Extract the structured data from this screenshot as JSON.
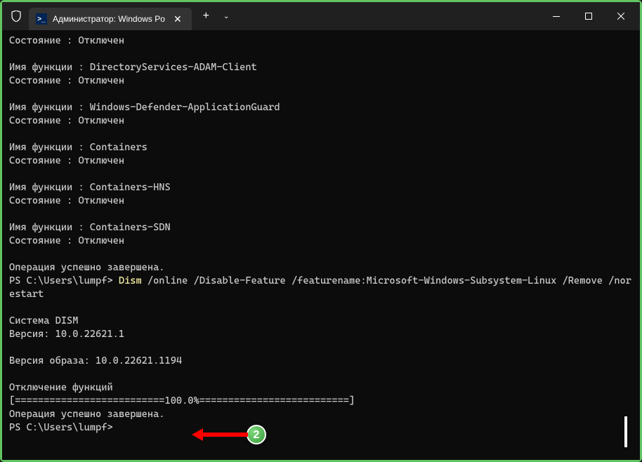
{
  "tab": {
    "title": "Администратор: Windows Po",
    "icon_glyph": ">_"
  },
  "terminal": {
    "lines": [
      {
        "text": "Состояние : Отключен"
      },
      {
        "text": ""
      },
      {
        "text": "Имя функции : DirectoryServices-ADAM-Client"
      },
      {
        "text": "Состояние : Отключен"
      },
      {
        "text": ""
      },
      {
        "text": "Имя функции : Windows-Defender-ApplicationGuard"
      },
      {
        "text": "Состояние : Отключен"
      },
      {
        "text": ""
      },
      {
        "text": "Имя функции : Containers"
      },
      {
        "text": "Состояние : Отключен"
      },
      {
        "text": ""
      },
      {
        "text": "Имя функции : Containers-HNS"
      },
      {
        "text": "Состояние : Отключен"
      },
      {
        "text": ""
      },
      {
        "text": "Имя функции : Containers-SDN"
      },
      {
        "text": "Состояние : Отключен"
      },
      {
        "text": ""
      },
      {
        "text": "Операция успешно завершена."
      }
    ],
    "prompt": "PS C:\\Users\\lumpf> ",
    "command": "Dism",
    "command_args": " /online /Disable-Feature /featurename:Microsoft-Windows-Subsystem-Linux /Remove /norestart",
    "output2": [
      "",
      "Cистема DISM",
      "Версия: 10.0.22621.1",
      "",
      "Версия образа: 10.0.22621.1194",
      "",
      "Отключение функций",
      "[==========================100.0%==========================]",
      "Операция успешно завершена."
    ],
    "final_prompt": "PS C:\\Users\\lumpf>"
  },
  "annotation": {
    "badge_number": "2"
  }
}
